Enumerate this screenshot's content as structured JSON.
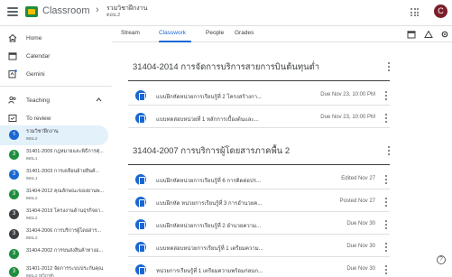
{
  "app": {
    "title": "Classroom",
    "breadcrumb_sep": "›",
    "class_title": "รวมวิชาฝึกงาน",
    "class_section": "ตอน.2",
    "avatar_letter": "C"
  },
  "sidebar": {
    "nav": [
      {
        "label": "Home",
        "icon": "home-icon"
      },
      {
        "label": "Calendar",
        "icon": "calendar-icon"
      },
      {
        "label": "Gemini",
        "icon": "gemini-icon"
      }
    ],
    "teaching_label": "Teaching",
    "to_review_label": "To review",
    "classes": [
      {
        "badge": "ร",
        "name": "รวมวิชาฝึกงาน",
        "section": "ตอน.2",
        "color": "#1967d2",
        "active": true
      },
      {
        "badge": "3",
        "name": "31401-2009 กฎหมายและพิธีการศุ...",
        "section": "ตอน.1",
        "color": "#1e8e3e"
      },
      {
        "badge": "3",
        "name": "31401-2003 การเคลื่อนย้ายสินค้...",
        "section": "ตอน.1",
        "color": "#1967d2"
      },
      {
        "badge": "3",
        "name": "31404-2012 คุณลักษณะของยานพ...",
        "section": "ตอน.2",
        "color": "#1e8e3e"
      },
      {
        "badge": "3",
        "name": "31404-2019 โครงงานด้านธุรกิจยา...",
        "section": "ตอน.2",
        "color": "#3c4043"
      },
      {
        "badge": "3",
        "name": "31404-2006 การบริการผู้โดยสาร...",
        "section": "ตอน.2",
        "color": "#3c4043"
      },
      {
        "badge": "3",
        "name": "31404-2002 การขนส่งสินค้าทางอ...",
        "section": "",
        "color": "#1e8e3e"
      },
      {
        "badge": "3",
        "name": "31401-2012 จัดการระบบประกันคุณ...",
        "section": "ตอน.2 (ทวิภาคี)",
        "color": "#1e8e3e"
      }
    ]
  },
  "tabs": {
    "items": [
      "Stream",
      "Classwork",
      "People",
      "Grades"
    ],
    "active": "Classwork"
  },
  "topics": [
    {
      "title": "31404-2014 การจัดการบริการสายการบินต้นทุนต่ำ",
      "items": [
        {
          "title": "แบบฝึกหัดหน่วยการเรียนรู้ที่ 2 โครงสร้างกา...",
          "date": "Due Nov 23, 10:00 PM"
        },
        {
          "title": "แบบทดสอบหน่วยที่ 1 หลักการเบื้องต้นและ...",
          "date": "Due Nov 23, 10:00 PM"
        }
      ]
    },
    {
      "title": "31404-2007 การบริการผู้โดยสารภาคพื้น 2",
      "items": [
        {
          "title": "แบบฝึกหัดหน่วยการเรียนรู้ที่ 6 การติดต่อปร...",
          "date": "Edited Nov 27"
        },
        {
          "title": "แบบฝึกหัด หน่วยการเรียนรู้ที่ 3 การอำนวยค...",
          "date": "Posted Nov 27"
        },
        {
          "title": "แบบฝึกหัดหน่วยการเรียนรู้ที่ 2 อำนวยความ...",
          "date": "Due Nov 30"
        },
        {
          "title": "แบบทดสอบหน่วยการเรียนรู้ที่ 1 เตรียมความ...",
          "date": "Due Nov 30"
        },
        {
          "title": "หน่วยการเรียนรู้ที่ 1 เตรียมความพร้อมก่อนก...",
          "date": "Due Nov 30"
        }
      ]
    }
  ],
  "help_glyph": "?"
}
